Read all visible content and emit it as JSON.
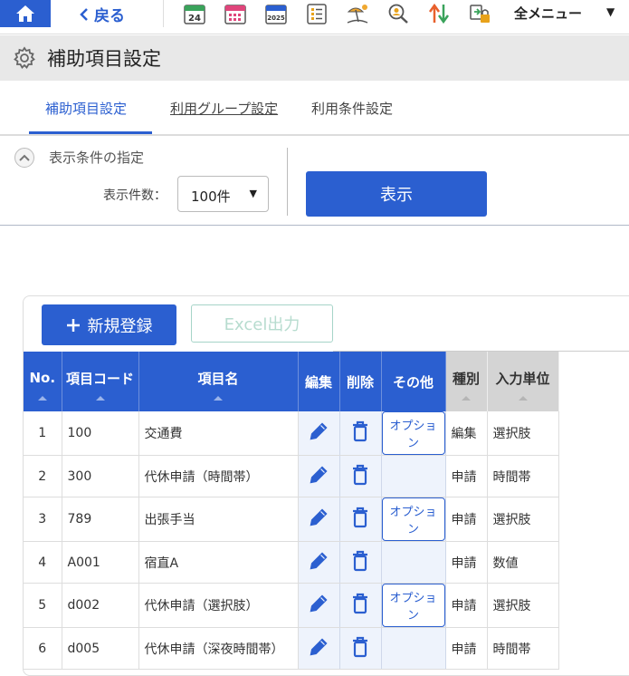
{
  "topbar": {
    "back_label": "戻る",
    "all_menu_label": "全メニュー",
    "icons": [
      "calendar-24-icon",
      "calendar-grid-icon",
      "calendar-2025-icon",
      "checklist-icon",
      "beach-icon",
      "person-search-icon",
      "transfer-arrows-icon",
      "lock-transfer-icon"
    ],
    "cal_24_text": "24",
    "cal_2025_text": "2025"
  },
  "page": {
    "title": "補助項目設定"
  },
  "tabs": [
    {
      "label": "補助項目設定"
    },
    {
      "label": "利用グループ設定"
    },
    {
      "label": "利用条件設定"
    }
  ],
  "filter": {
    "condition_label": "表示条件の指定",
    "count_label": "表示件数：",
    "count_value": "100件",
    "show_button": "表示"
  },
  "actions": {
    "new_button": "新規登録",
    "excel_button": "Excel出力"
  },
  "table": {
    "headers": [
      "No.",
      "項目コード",
      "項目名",
      "編集",
      "削除",
      "その他",
      "種別",
      "入力単位"
    ],
    "option_label": "オプション",
    "rows": [
      {
        "no": "1",
        "code": "100",
        "name": "交通費",
        "has_option": true,
        "type": "編集",
        "unit": "選択肢"
      },
      {
        "no": "2",
        "code": "300",
        "name": "代休申請（時間帯）",
        "has_option": false,
        "type": "申請",
        "unit": "時間帯"
      },
      {
        "no": "3",
        "code": "789",
        "name": "出張手当",
        "has_option": true,
        "type": "申請",
        "unit": "選択肢"
      },
      {
        "no": "4",
        "code": "A001",
        "name": "宿直A",
        "has_option": false,
        "type": "申請",
        "unit": "数値"
      },
      {
        "no": "5",
        "code": "d002",
        "name": "代休申請（選択肢）",
        "has_option": true,
        "type": "申請",
        "unit": "選択肢"
      },
      {
        "no": "6",
        "code": "d005",
        "name": "代休申請（深夜時間帯）",
        "has_option": false,
        "type": "申請",
        "unit": "時間帯"
      }
    ]
  },
  "colors": {
    "accent": "#2b5fd0",
    "title_bar": "#e8e8e8",
    "header_gray": "#d4d4d4",
    "action_cell": "#eef3fc"
  }
}
